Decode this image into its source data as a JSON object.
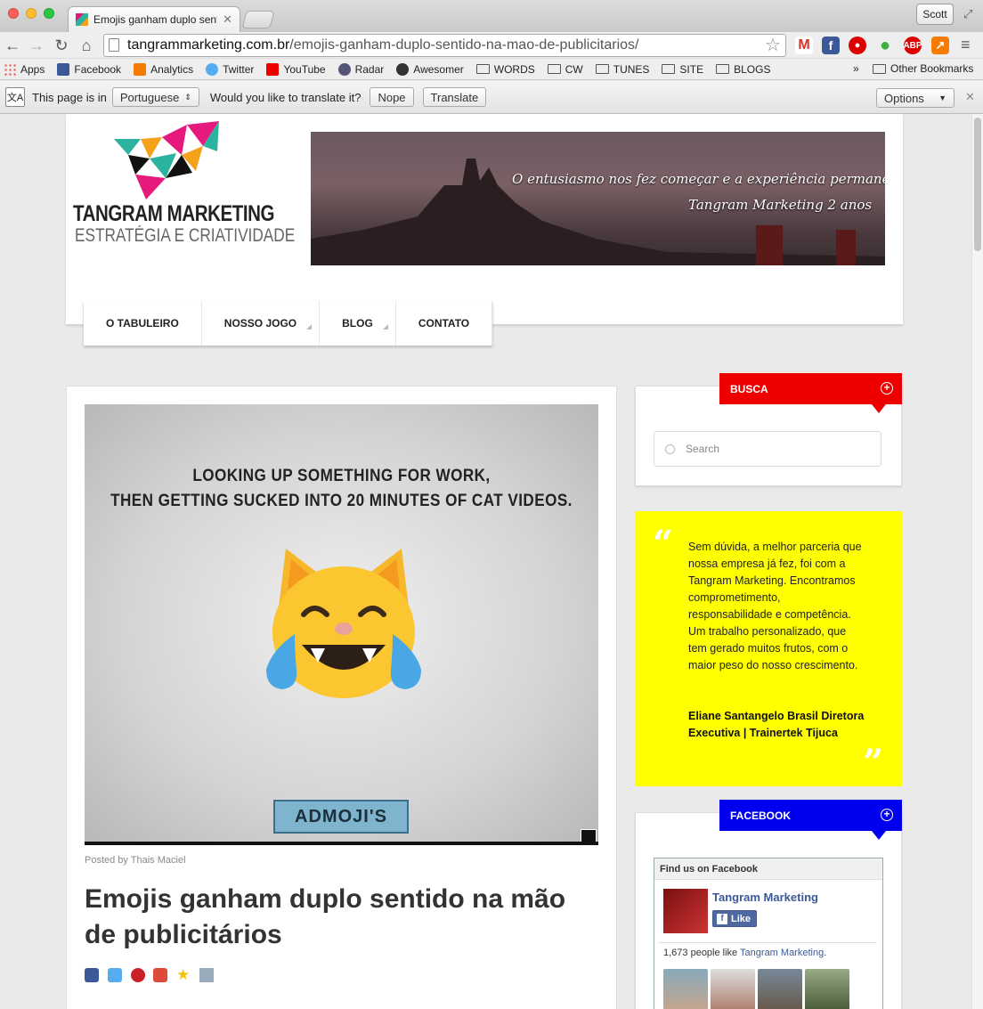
{
  "browser": {
    "tab_title": "Emojis ganham duplo sentido na mão de publicitários",
    "profile_name": "Scott",
    "url_host": "tangrammarketing.com.br",
    "url_path": "/emojis-ganham-duplo-sentido-na-mao-de-publicitarios/",
    "bookmarks": [
      "Apps",
      "Facebook",
      "Analytics",
      "Twitter",
      "YouTube",
      "Radar",
      "Awesomer",
      "WORDS",
      "CW",
      "TUNES",
      "SITE",
      "BLOGS"
    ],
    "bookmarks_more": "»",
    "other_bookmarks": "Other Bookmarks",
    "extensions": {
      "abp": "ABP"
    }
  },
  "translate_bar": {
    "prefix": "This page is in",
    "language": "Portuguese",
    "question": "Would you like to translate it?",
    "nope": "Nope",
    "translate": "Translate",
    "options": "Options"
  },
  "site": {
    "brand_name": "TANGRAM MARKETING",
    "brand_tagline": "ESTRATÉGIA E CRIATIVIDADE",
    "banner_line1": "O entusiasmo nos fez começar e a experiência permanecer",
    "banner_line2": "Tangram Marketing 2 anos",
    "nav": [
      "O TABULEIRO",
      "NOSSO JOGO",
      "BLOG",
      "CONTATO"
    ]
  },
  "post": {
    "image_caption_1": "LOOKING UP SOMETHING FOR WORK,",
    "image_caption_2": "THEN GETTING SUCKED INTO 20 MINUTES OF CAT VIDEOS.",
    "image_badge": "ADMOJI'S",
    "posted_by": "Posted by Thais Maciel",
    "title": "Emojis ganham duplo sentido na mão de publicitários"
  },
  "sidebar": {
    "busca_title": "BUSCA",
    "search_placeholder": "Search",
    "testimonial": "Sem dúvida, a melhor parceria que nossa empresa já fez, foi com a Tangram Marketing. Encontramos comprometimento, responsabilidade e competência. Um trabalho personalizado, que tem gerado muitos frutos, com o maior peso do nosso crescimento.",
    "testimonial_author": "Eliane Santangelo Brasil Diretora Executiva | Trainertek Tijuca",
    "facebook_title": "FACEBOOK",
    "fb_find": "Find us on Facebook",
    "fb_page": "Tangram Marketing",
    "fb_like": "Like",
    "fb_count": "1,673 people like",
    "fb_count_link": "Tangram Marketing",
    "fb_count_end": "."
  },
  "colors": {
    "busca_red": "#ee0000",
    "quote_yellow": "#ffff00",
    "fb_blue": "#0000ee"
  }
}
